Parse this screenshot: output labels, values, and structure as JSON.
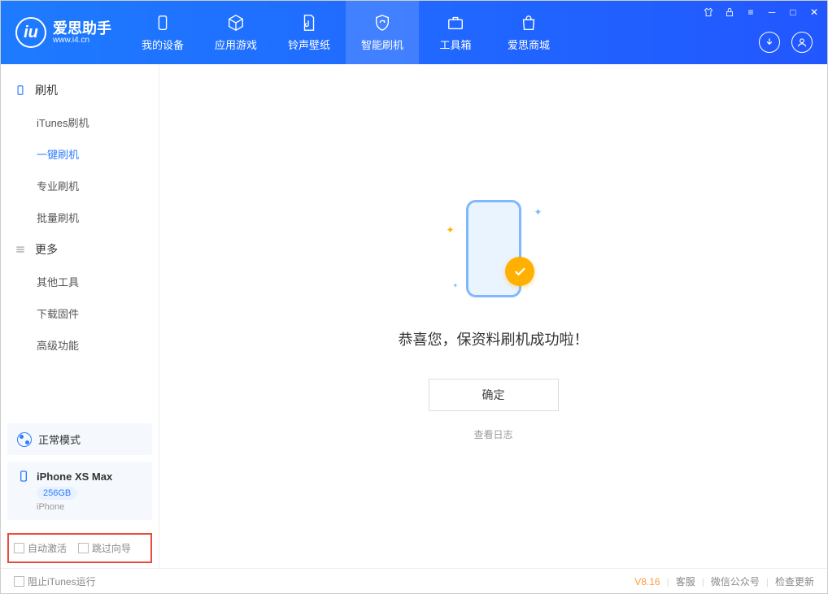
{
  "header": {
    "app_name": "爱思助手",
    "app_url": "www.i4.cn",
    "tabs": [
      {
        "label": "我的设备"
      },
      {
        "label": "应用游戏"
      },
      {
        "label": "铃声壁纸"
      },
      {
        "label": "智能刷机"
      },
      {
        "label": "工具箱"
      },
      {
        "label": "爱思商城"
      }
    ]
  },
  "sidebar": {
    "group1_title": "刷机",
    "group1_items": [
      {
        "label": "iTunes刷机"
      },
      {
        "label": "一键刷机"
      },
      {
        "label": "专业刷机"
      },
      {
        "label": "批量刷机"
      }
    ],
    "group2_title": "更多",
    "group2_items": [
      {
        "label": "其他工具"
      },
      {
        "label": "下载固件"
      },
      {
        "label": "高级功能"
      }
    ],
    "mode_label": "正常模式",
    "device": {
      "name": "iPhone XS Max",
      "capacity": "256GB",
      "type": "iPhone"
    },
    "checkbox1": "自动激活",
    "checkbox2": "跳过向导"
  },
  "main": {
    "success_text": "恭喜您，保资料刷机成功啦！",
    "ok_button": "确定",
    "log_link": "查看日志"
  },
  "statusbar": {
    "stop_itunes": "阻止iTunes运行",
    "version": "V8.16",
    "links": [
      "客服",
      "微信公众号",
      "检查更新"
    ]
  }
}
